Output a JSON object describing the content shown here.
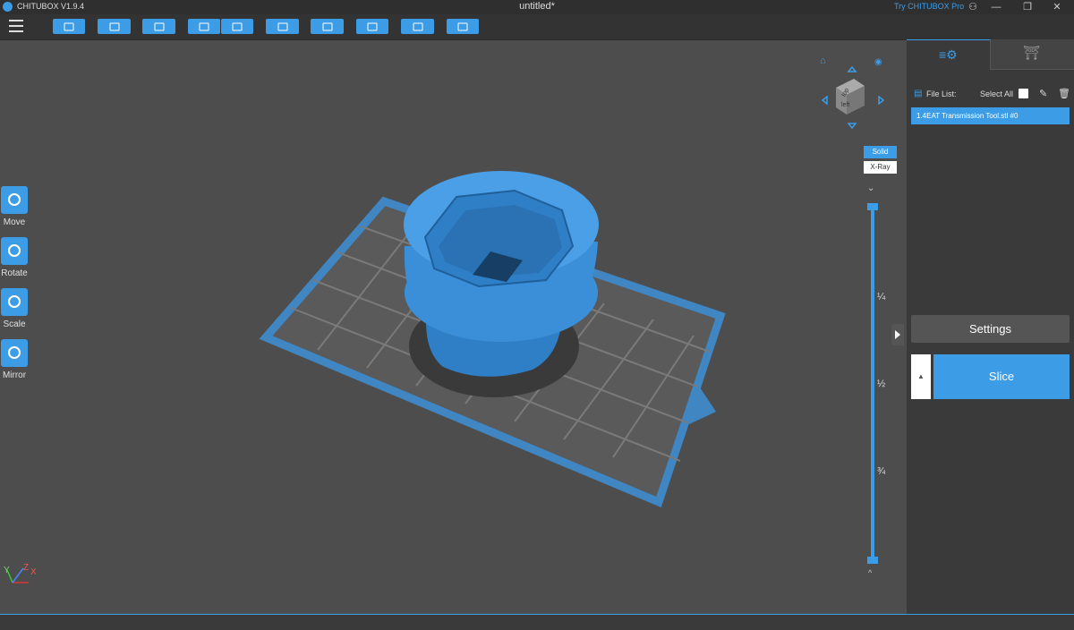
{
  "app": {
    "name": "CHITUBOX V1.9.4",
    "document_title": "untitled*",
    "pro_link": "Try CHITUBOX Pro"
  },
  "window_controls": [
    "user-icon",
    "minimize-icon",
    "restore-icon",
    "close-icon"
  ],
  "toolbar": {
    "buttons": [
      "open-file-icon",
      "save-icon",
      "import-icon",
      "undo-icon",
      "redo-icon",
      "copy-icon",
      "arrange-icon",
      "hollow-icon",
      "center-icon",
      "lock-icon"
    ]
  },
  "left_tools": [
    {
      "label": "Move",
      "icon": "move-icon"
    },
    {
      "label": "Rotate",
      "icon": "rotate-icon"
    },
    {
      "label": "Scale",
      "icon": "scale-icon"
    },
    {
      "label": "Mirror",
      "icon": "mirror-icon"
    }
  ],
  "view": {
    "solid_label": "Solid",
    "xray_label": "X-Ray",
    "cube_top": "top",
    "cube_left": "left"
  },
  "layer_slider": {
    "marks": [
      "¼",
      "½",
      "¾"
    ],
    "top_value": 1.0,
    "bottom_value": 0.0
  },
  "right_panel": {
    "file_list_label": "File List:",
    "select_all_label": "Select All",
    "files": [
      "1.4EAT Transmission Tool.stl #0"
    ],
    "settings_label": "Settings",
    "slice_label": "Slice"
  },
  "axis_labels": {
    "x": "X",
    "y": "Y",
    "z": "Z"
  },
  "colors": {
    "accent": "#3d9ce6",
    "viewport_bg": "#4d4d4d",
    "panel_bg": "#3a3a3a",
    "model": "#3a8fd8"
  }
}
